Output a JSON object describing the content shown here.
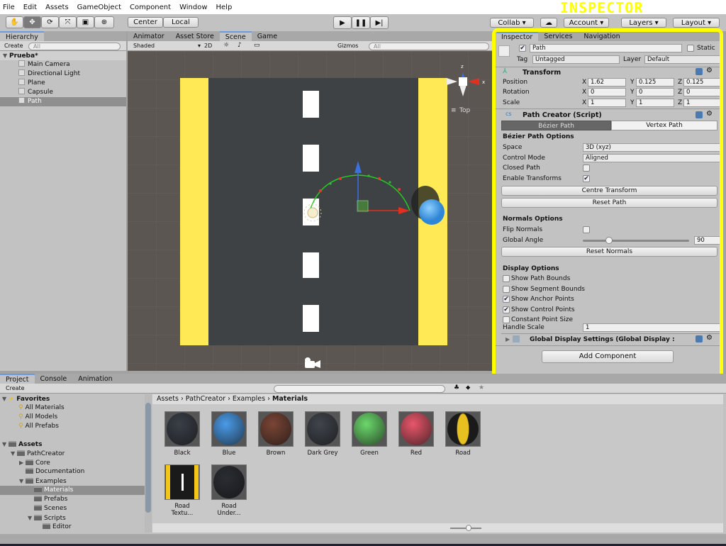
{
  "menu": [
    "File",
    "Edit",
    "Assets",
    "GameObject",
    "Component",
    "Window",
    "Help"
  ],
  "toolbar": {
    "tools": [
      "hand-icon",
      "move-icon",
      "rotate-icon",
      "scale-icon",
      "rect-icon",
      "transform-icon"
    ],
    "pivot": "Center",
    "space": "Local",
    "collab": "Collab",
    "account": "Account",
    "layers": "Layers",
    "layout": "Layout"
  },
  "annotation": "INSPECTOR",
  "annotation_color": "#ffff00",
  "hierarchy": {
    "tab": "Hierarchy",
    "create": "Create",
    "search_placeholder": "All",
    "scene": "Prueba*",
    "items": [
      "Main Camera",
      "Directional Light",
      "Plane",
      "Capsule",
      "Path"
    ],
    "selected": "Path"
  },
  "scene": {
    "tabs": [
      "Animator",
      "Asset Store",
      "Scene",
      "Game"
    ],
    "active_tab": "Scene",
    "shading": "Shaded",
    "mode2d": "2D",
    "gizmos": "Gizmos",
    "search_placeholder": "All",
    "view_label": "Top",
    "axis_x": "x",
    "axis_z": "z"
  },
  "inspector": {
    "tabs": [
      "Inspector",
      "Services",
      "Navigation"
    ],
    "name": "Path",
    "active": true,
    "static_label": "Static",
    "tag_label": "Tag",
    "tag": "Untagged",
    "layer_label": "Layer",
    "layer": "Default",
    "transform": {
      "title": "Transform",
      "rows": [
        {
          "label": "Position",
          "x": "1.62",
          "y": "0.125",
          "z": "0.125"
        },
        {
          "label": "Rotation",
          "x": "0",
          "y": "0",
          "z": "0"
        },
        {
          "label": "Scale",
          "x": "1",
          "y": "1",
          "z": "1"
        }
      ]
    },
    "path_creator": {
      "title": "Path Creator (Script)",
      "tab_bezier": "Bézier Path",
      "tab_vertex": "Vertex Path",
      "bezier_title": "Bézier Path Options",
      "space_label": "Space",
      "space": "3D (xyz)",
      "control_label": "Control Mode",
      "control": "Aligned",
      "closed_label": "Closed Path",
      "closed": false,
      "enable_label": "Enable Transforms",
      "enable": true,
      "centre_btn": "Centre Transform",
      "reset_btn": "Reset Path",
      "normals_title": "Normals Options",
      "flip_label": "Flip Normals",
      "flip": false,
      "angle_label": "Global Angle",
      "angle": "90",
      "reset_normals": "Reset Normals",
      "display_title": "Display Options",
      "display": [
        {
          "label": "Show Path Bounds",
          "checked": false
        },
        {
          "label": "Show Segment Bounds",
          "checked": false
        },
        {
          "label": "Show Anchor Points",
          "checked": true
        },
        {
          "label": "Show Control Points",
          "checked": true
        },
        {
          "label": "Constant Point Size",
          "checked": false
        }
      ],
      "handle_label": "Handle Scale",
      "handle": "1"
    },
    "global_display": "Global Display Settings (Global Display :",
    "add_component": "Add Component"
  },
  "project": {
    "tabs": [
      "Project",
      "Console",
      "Animation"
    ],
    "create": "Create",
    "favorites": {
      "label": "Favorites",
      "items": [
        "All Materials",
        "All Models",
        "All Prefabs"
      ]
    },
    "assets": {
      "label": "Assets",
      "tree": [
        {
          "label": "PathCreator",
          "depth": 1,
          "arrow": "▼"
        },
        {
          "label": "Core",
          "depth": 2,
          "arrow": "▶"
        },
        {
          "label": "Documentation",
          "depth": 2,
          "arrow": ""
        },
        {
          "label": "Examples",
          "depth": 2,
          "arrow": "▼"
        },
        {
          "label": "Materials",
          "depth": 3,
          "arrow": "",
          "selected": true
        },
        {
          "label": "Prefabs",
          "depth": 3,
          "arrow": ""
        },
        {
          "label": "Scenes",
          "depth": 3,
          "arrow": ""
        },
        {
          "label": "Scripts",
          "depth": 3,
          "arrow": "▼"
        },
        {
          "label": "Editor",
          "depth": 4,
          "arrow": ""
        }
      ]
    },
    "breadcrumb": [
      "Assets",
      "PathCreator",
      "Examples",
      "Materials"
    ],
    "materials": [
      {
        "name": "Black",
        "color": "#3a3f48"
      },
      {
        "name": "Blue",
        "color": "#4a9be8"
      },
      {
        "name": "Brown",
        "color": "#7a4535"
      },
      {
        "name": "Dark Grey",
        "color": "#40444c"
      },
      {
        "name": "Green",
        "color": "#6bd86b"
      },
      {
        "name": "Red",
        "color": "#e8566a"
      },
      {
        "name": "Road",
        "color": "#1a1a1a"
      },
      {
        "name": "Road Textu...",
        "color": "#1a1a1a"
      },
      {
        "name": "Road Under...",
        "color": "#2a2d32"
      }
    ]
  }
}
